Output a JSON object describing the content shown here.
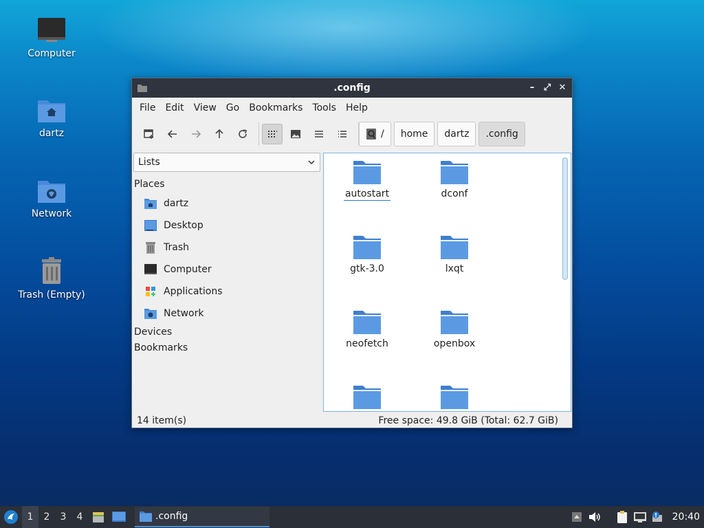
{
  "desktop": {
    "icons": [
      {
        "label": "Computer"
      },
      {
        "label": "dartz"
      },
      {
        "label": "Network"
      },
      {
        "label": "Trash (Empty)"
      }
    ]
  },
  "window": {
    "title": ".config",
    "menu": [
      "File",
      "Edit",
      "View",
      "Go",
      "Bookmarks",
      "Tools",
      "Help"
    ],
    "breadcrumbs": [
      "/",
      "home",
      "dartz",
      ".config"
    ],
    "side": {
      "selector_value": "Lists",
      "places_heading": "Places",
      "places": [
        {
          "label": "dartz",
          "icon": "home-folder-icon"
        },
        {
          "label": "Desktop",
          "icon": "desktop-icon"
        },
        {
          "label": "Trash",
          "icon": "trash-icon"
        },
        {
          "label": "Computer",
          "icon": "computer-icon"
        },
        {
          "label": "Applications",
          "icon": "applications-icon"
        },
        {
          "label": "Network",
          "icon": "network-folder-icon"
        }
      ],
      "devices_heading": "Devices",
      "bookmarks_heading": "Bookmarks"
    },
    "files": [
      {
        "name": "autostart"
      },
      {
        "name": "dconf"
      },
      {
        "name": "gtk-3.0"
      },
      {
        "name": "lxqt"
      },
      {
        "name": "neofetch"
      },
      {
        "name": "openbox"
      },
      {
        "name": ""
      },
      {
        "name": ""
      }
    ],
    "status": {
      "items": "14 item(s)",
      "free_space": "Free space: 49.8 GiB (Total: 62.7 GiB)"
    }
  },
  "taskbar": {
    "workspaces": [
      "1",
      "2",
      "3",
      "4"
    ],
    "active_workspace": "1",
    "task_label": ".config",
    "clock": "20:40"
  },
  "colors": {
    "folder": "#4a8ad8",
    "accent": "#2b78c8",
    "titlebar": "#2f343f",
    "taskbar": "#2a2f38"
  }
}
